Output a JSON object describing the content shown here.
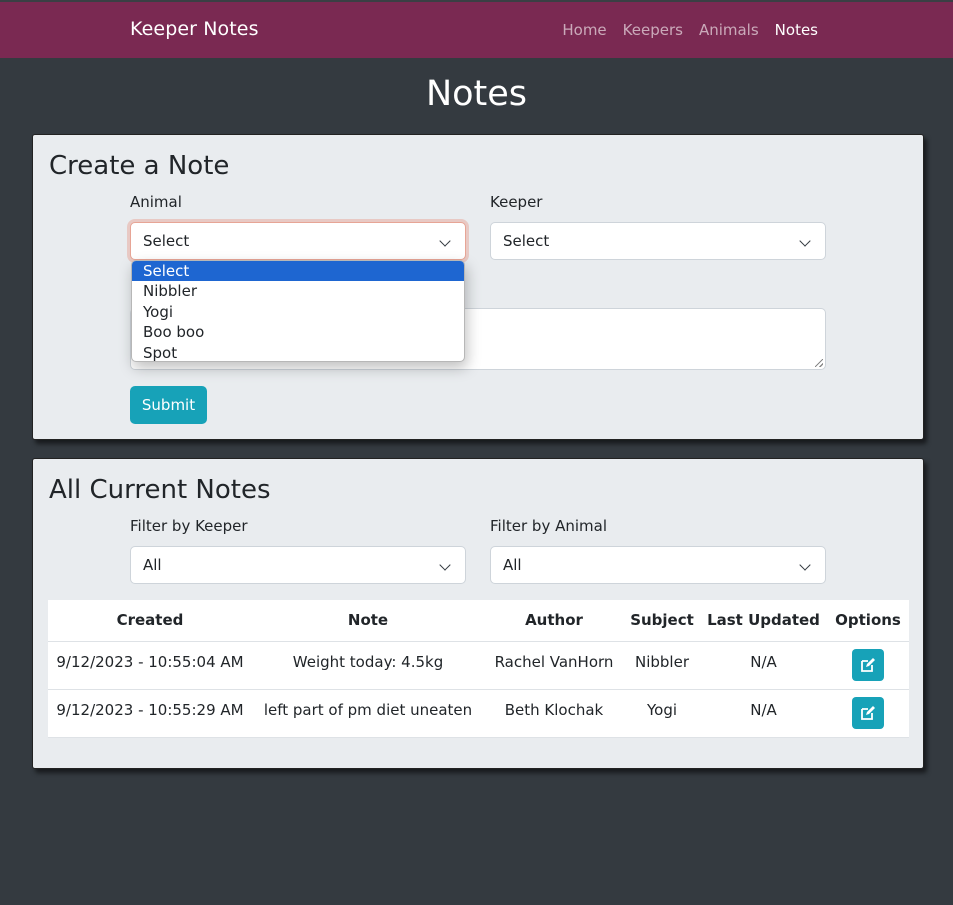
{
  "navbar": {
    "brand": "Keeper Notes",
    "links": [
      {
        "label": "Home"
      },
      {
        "label": "Keepers"
      },
      {
        "label": "Animals"
      },
      {
        "label": "Notes"
      }
    ]
  },
  "page_title": "Notes",
  "create_card": {
    "title": "Create a Note",
    "animal_label": "Animal",
    "animal_value": "Select",
    "keeper_label": "Keeper",
    "keeper_value": "Select",
    "submit_label": "Submit",
    "animal_options": [
      "Select",
      "Nibbler",
      "Yogi",
      "Boo boo",
      "Spot"
    ]
  },
  "notes_card": {
    "title": "All Current Notes",
    "filter_keeper_label": "Filter by Keeper",
    "filter_keeper_value": "All",
    "filter_animal_label": "Filter by Animal",
    "filter_animal_value": "All",
    "columns": [
      "Created",
      "Note",
      "Author",
      "Subject",
      "Last Updated",
      "Options"
    ],
    "rows": [
      {
        "created": "9/12/2023 - 10:55:04 AM",
        "note": "Weight today: 4.5kg",
        "author": "Rachel VanHorn",
        "subject": "Nibbler",
        "last_updated": "N/A"
      },
      {
        "created": "9/12/2023 - 10:55:29 AM",
        "note": "left part of pm diet uneaten",
        "author": "Beth Klochak",
        "subject": "Yogi",
        "last_updated": "N/A"
      }
    ]
  },
  "colors": {
    "navbar": "#7a2952",
    "background": "#343a40",
    "card": "#e9ecef",
    "accent": "#17a2b8",
    "option_selected": "#1e66d1"
  },
  "icons": {
    "edit": "pencil-square-icon",
    "select": "chevron-down-icon"
  }
}
